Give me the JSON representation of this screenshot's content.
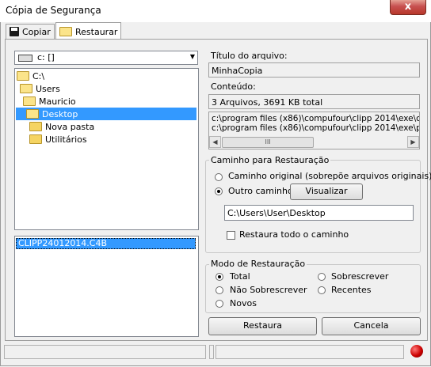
{
  "window": {
    "title": "Cópia de Segurança",
    "close_glyph": "x"
  },
  "tabs": [
    {
      "label": "Copiar",
      "icon": "floppy-disk-icon",
      "active": false
    },
    {
      "label": "Restaurar",
      "icon": "open-folder-icon",
      "active": true
    }
  ],
  "drive_select": {
    "value": "c: []",
    "arrow": "▼"
  },
  "folder_tree": [
    {
      "label": "C:\\",
      "open": true,
      "selected": false
    },
    {
      "label": "Users",
      "open": true,
      "selected": false
    },
    {
      "label": "Mauricio",
      "open": true,
      "selected": false
    },
    {
      "label": "Desktop",
      "open": true,
      "selected": true
    },
    {
      "label": "Nova pasta",
      "open": false,
      "selected": false
    },
    {
      "label": "Utilitários",
      "open": false,
      "selected": false
    }
  ],
  "file_list": [
    "CLIPP24012014.C4B"
  ],
  "archive": {
    "title_label": "Título do arquivo:",
    "title_value": "MinhaCopia",
    "content_label": "Conteúdo:",
    "content_value": "3 Arquivos, 3691 KB total",
    "content_files": [
      "c:\\program files (x86)\\compufour\\clipp 2014\\exe\\co",
      "c:\\program files (x86)\\compufour\\clipp 2014\\exe\\pc"
    ],
    "scroll_grip": "III"
  },
  "restore_path": {
    "group_title": "Caminho para Restauração",
    "original_label": "Caminho original (sobrepõe arquivos originais)",
    "other_label": "Outro caminho:",
    "view_button": "Visualizar",
    "path_value": "C:\\Users\\User\\Desktop",
    "restore_all_label": "Restaura todo o caminho",
    "selected": "other",
    "restore_all_checked": false
  },
  "restore_mode": {
    "group_title": "Modo de Restauração",
    "options": [
      "Total",
      "Sobrescrever",
      "Não Sobrescrever",
      "Recentes",
      "Novos"
    ],
    "selected": "Total"
  },
  "actions": {
    "restore": "Restaura",
    "cancel": "Cancela"
  },
  "colors": {
    "selection": "#3399ff",
    "status_led": "#cc0000"
  }
}
